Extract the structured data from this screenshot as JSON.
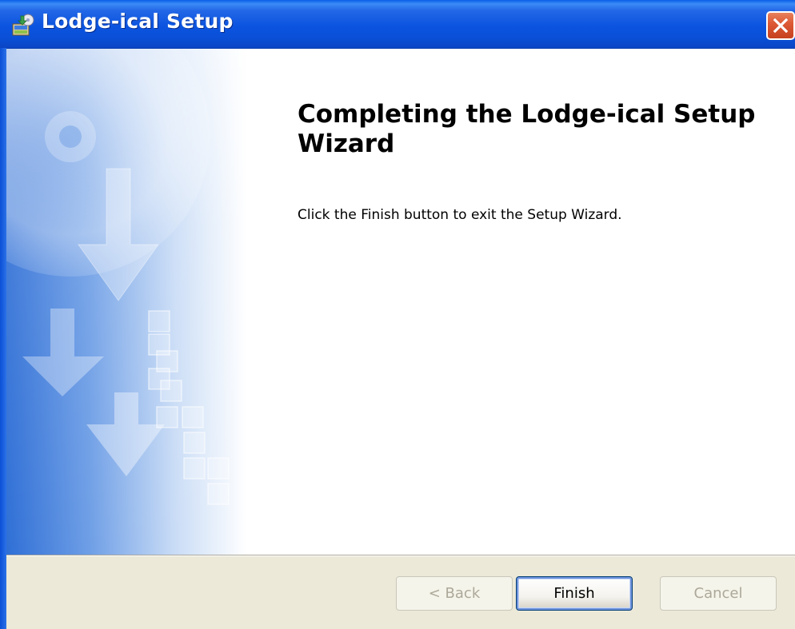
{
  "window": {
    "title": "Lodge-ical Setup",
    "icon": "installer-icon",
    "close_icon": "close-icon"
  },
  "main": {
    "heading": "Completing the Lodge-ical Setup Wizard",
    "message": "Click the Finish button to exit the Setup Wizard."
  },
  "buttons": {
    "back": "< Back",
    "finish": "Finish",
    "cancel": "Cancel"
  },
  "colors": {
    "titlebar": "#0a52de",
    "close": "#dd5a35",
    "dialog_face": "#ece9d8",
    "banner_blue": "#3a7bdc"
  }
}
